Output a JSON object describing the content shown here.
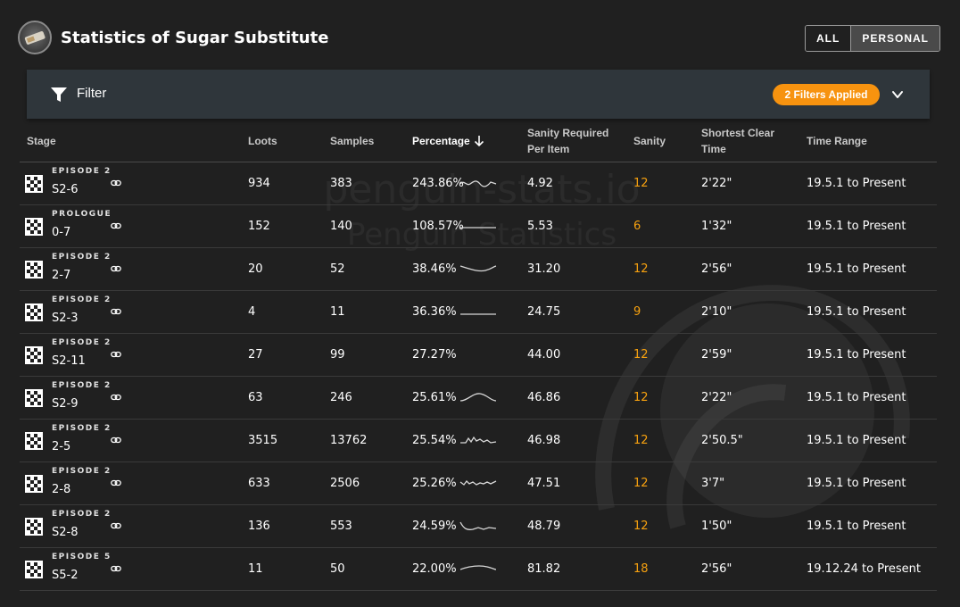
{
  "header": {
    "title": "Statistics of Sugar Substitute",
    "toggle": {
      "all_label": "ALL",
      "personal_label": "PERSONAL",
      "selected": "PERSONAL"
    }
  },
  "filter": {
    "label": "Filter",
    "badge": "2 Filters Applied"
  },
  "watermark": {
    "line1": "penguin-stats.io",
    "line2": "Penguin Statistics"
  },
  "table": {
    "columns": {
      "stage": "Stage",
      "loots": "Loots",
      "samples": "Samples",
      "percentage": "Percentage",
      "sanity_per_item_1": "Sanity Required",
      "sanity_per_item_2": "Per Item",
      "sanity": "Sanity",
      "clear_time_1": "Shortest Clear",
      "clear_time_2": "Time",
      "time_range": "Time Range"
    },
    "sort": {
      "column": "Percentage",
      "direction": "descending"
    },
    "rows": [
      {
        "zone": "EPISODE 2",
        "stage": "S2-6",
        "loots": "934",
        "samples": "383",
        "percentage": "243.86%",
        "sanity_per_item": "4.92",
        "sanity": "12",
        "clear_time": "2'22\"",
        "time_range": "19.5.1 to Present"
      },
      {
        "zone": "PROLOGUE",
        "stage": "0-7",
        "loots": "152",
        "samples": "140",
        "percentage": "108.57%",
        "sanity_per_item": "5.53",
        "sanity": "6",
        "clear_time": "1'32\"",
        "time_range": "19.5.1 to Present"
      },
      {
        "zone": "EPISODE 2",
        "stage": "2-7",
        "loots": "20",
        "samples": "52",
        "percentage": "38.46%",
        "sanity_per_item": "31.20",
        "sanity": "12",
        "clear_time": "2'56\"",
        "time_range": "19.5.1 to Present"
      },
      {
        "zone": "EPISODE 2",
        "stage": "S2-3",
        "loots": "4",
        "samples": "11",
        "percentage": "36.36%",
        "sanity_per_item": "24.75",
        "sanity": "9",
        "clear_time": "2'10\"",
        "time_range": "19.5.1 to Present"
      },
      {
        "zone": "EPISODE 2",
        "stage": "S2-11",
        "loots": "27",
        "samples": "99",
        "percentage": "27.27%",
        "sanity_per_item": "44.00",
        "sanity": "12",
        "clear_time": "2'59\"",
        "time_range": "19.5.1 to Present"
      },
      {
        "zone": "EPISODE 2",
        "stage": "S2-9",
        "loots": "63",
        "samples": "246",
        "percentage": "25.61%",
        "sanity_per_item": "46.86",
        "sanity": "12",
        "clear_time": "2'22\"",
        "time_range": "19.5.1 to Present"
      },
      {
        "zone": "EPISODE 2",
        "stage": "2-5",
        "loots": "3515",
        "samples": "13762",
        "percentage": "25.54%",
        "sanity_per_item": "46.98",
        "sanity": "12",
        "clear_time": "2'50.5\"",
        "time_range": "19.5.1 to Present"
      },
      {
        "zone": "EPISODE 2",
        "stage": "2-8",
        "loots": "633",
        "samples": "2506",
        "percentage": "25.26%",
        "sanity_per_item": "47.51",
        "sanity": "12",
        "clear_time": "3'7\"",
        "time_range": "19.5.1 to Present"
      },
      {
        "zone": "EPISODE 2",
        "stage": "S2-8",
        "loots": "136",
        "samples": "553",
        "percentage": "24.59%",
        "sanity_per_item": "48.79",
        "sanity": "12",
        "clear_time": "1'50\"",
        "time_range": "19.5.1 to Present"
      },
      {
        "zone": "EPISODE 5",
        "stage": "S5-2",
        "loots": "11",
        "samples": "50",
        "percentage": "22.00%",
        "sanity_per_item": "81.82",
        "sanity": "18",
        "clear_time": "2'56\"",
        "time_range": "19.12.24 to Present"
      }
    ]
  },
  "colors": {
    "background": "#202020",
    "filter_bar": "#2f363b",
    "accent_orange": "#f7930f",
    "sanity_text": "#f7a10f"
  },
  "icons": {
    "item": "sugar-substitute-icon",
    "filter": "filter-icon",
    "expand": "chevron-down-icon",
    "stage": "checkered-flag-icon",
    "link": "link-icon",
    "sort": "arrow-down-icon"
  }
}
